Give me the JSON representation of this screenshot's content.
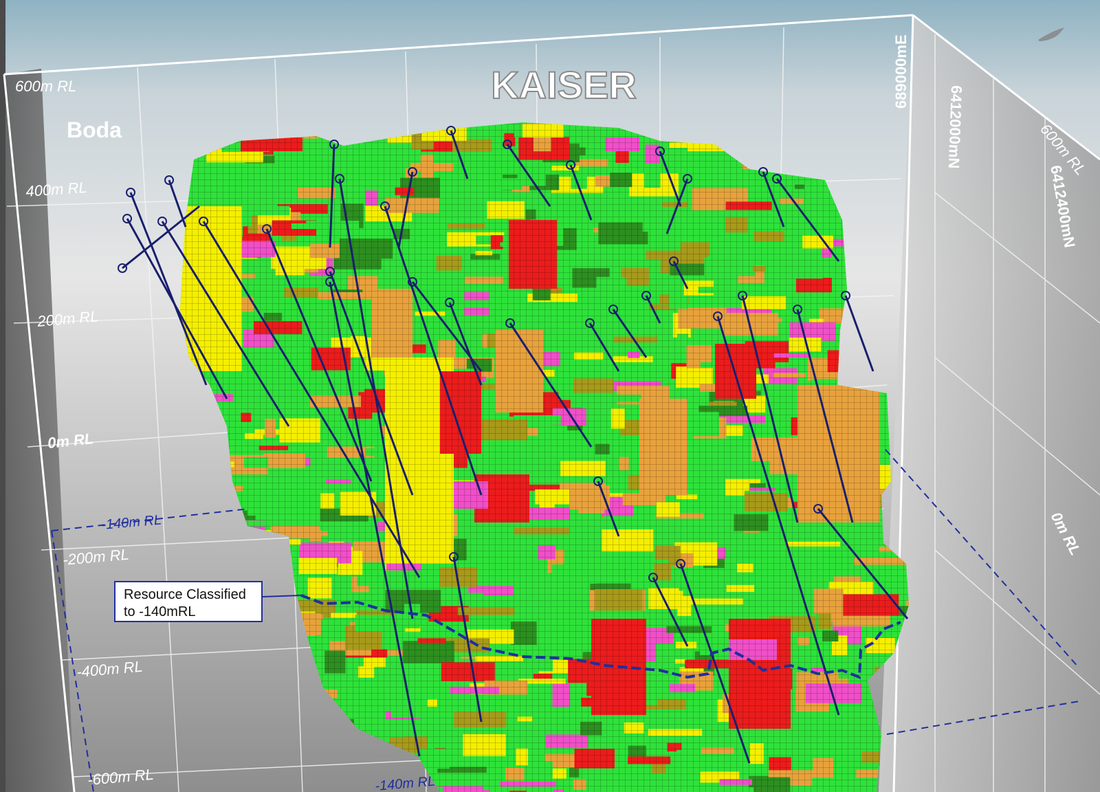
{
  "title": "KAISER",
  "deposit_label": "Boda",
  "rl_labels_left": [
    "600m RL",
    "400m RL",
    "200m RL",
    "0m RL",
    "-200m RL",
    "-400m RL",
    "-600m RL"
  ],
  "rl_labels_right": [
    "600m RL",
    "0m RL"
  ],
  "blue_rl_labels": [
    "-140m RL",
    "-140m RL"
  ],
  "grid_labels": {
    "easting": "689000mE",
    "northing_1": "6412000mN",
    "northing_2": "6412400mN"
  },
  "callout": {
    "line1": "Resource Classified",
    "line2": "to -140mRL"
  },
  "colors": {
    "green": "#2ee23a",
    "dark_green": "#2c8f1f",
    "yellow": "#f5ef00",
    "orange": "#e8a23c",
    "red": "#ec1c1c",
    "pink": "#f04fc8",
    "olive": "#a89a1a",
    "drillhole": "#1a1f6e",
    "boundary_blue": "#1f2fa0"
  }
}
